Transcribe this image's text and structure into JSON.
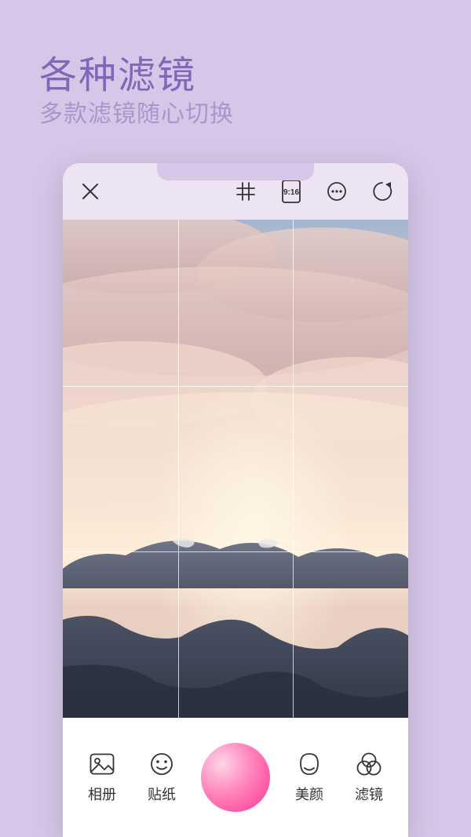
{
  "hero": {
    "title": "各种滤镜",
    "subtitle": "多款滤镜随心切换"
  },
  "topbar": {
    "aspect_label": "9:16"
  },
  "bottombar": {
    "album": "相册",
    "sticker": "贴纸",
    "beauty": "美颜",
    "filter": "滤镜"
  }
}
